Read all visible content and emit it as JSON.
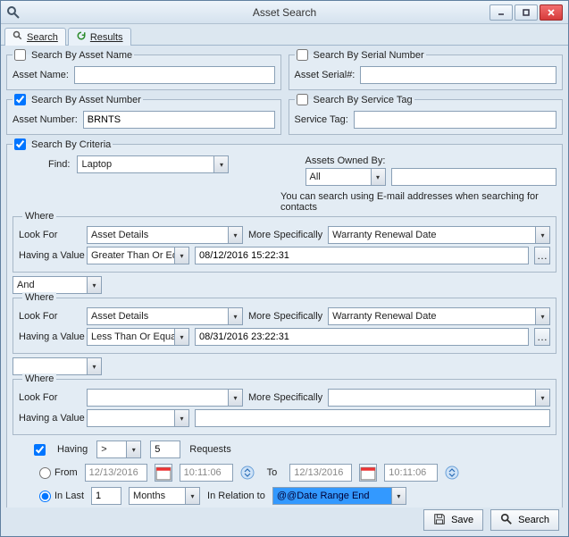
{
  "window": {
    "title": "Asset Search"
  },
  "tabs": {
    "search": "Search",
    "results": "Results"
  },
  "searchByName": {
    "legend": "Search By Asset Name",
    "checked": false,
    "label": "Asset Name:",
    "value": ""
  },
  "searchBySerial": {
    "legend": "Search By Serial Number",
    "checked": false,
    "label": "Asset Serial#:",
    "value": ""
  },
  "searchByNumber": {
    "legend": "Search By Asset Number",
    "checked": true,
    "label": "Asset Number:",
    "value": "BRNTS"
  },
  "searchByServiceTag": {
    "legend": "Search By Service Tag",
    "checked": false,
    "label": "Service Tag:",
    "value": ""
  },
  "criteria": {
    "legend": "Search By Criteria",
    "checked": true,
    "findLabel": "Find:",
    "findValue": "Laptop",
    "ownedLabel": "Assets Owned By:",
    "ownedScope": "All",
    "ownedValue": "",
    "hint": "You can search using E-mail addresses when searching for contacts",
    "where1": {
      "legend": "Where",
      "lookForLabel": "Look For",
      "lookForValue": "Asset Details",
      "moreLabel": "More Specifically",
      "moreValue": "Warranty Renewal Date",
      "havingLabel": "Having a Value",
      "opValue": "Greater Than Or Equal To",
      "valValue": "08/12/2016 15:22:31"
    },
    "boolOp1": "And",
    "where2": {
      "legend": "Where",
      "lookForLabel": "Look For",
      "lookForValue": "Asset Details",
      "moreLabel": "More Specifically",
      "moreValue": "Warranty Renewal Date",
      "havingLabel": "Having a Value",
      "opValue": "Less Than Or Equal To",
      "valValue": "08/31/2016 23:22:31"
    },
    "boolOp2": "",
    "where3": {
      "legend": "Where",
      "lookForLabel": "Look For",
      "lookForValue": "",
      "moreLabel": "More Specifically",
      "moreValue": "",
      "havingLabel": "Having a Value",
      "opValue": "",
      "valValue": ""
    },
    "having": {
      "checked": true,
      "label": "Having",
      "op": ">",
      "count": "5",
      "suffix": "Requests",
      "fromLabel": "From",
      "fromDate": "12/13/2016",
      "fromTime": "10:11:06",
      "toLabel": "To",
      "toDate": "12/13/2016",
      "toTime": "10:11:06",
      "inLastLabel": "In Last",
      "inLastCount": "1",
      "inLastUnit": "Months",
      "inRelationLabel": "In Relation to",
      "inRelationValue": "@@Date Range End",
      "mode": "inlast"
    }
  },
  "footer": {
    "save": "Save",
    "search": "Search"
  }
}
